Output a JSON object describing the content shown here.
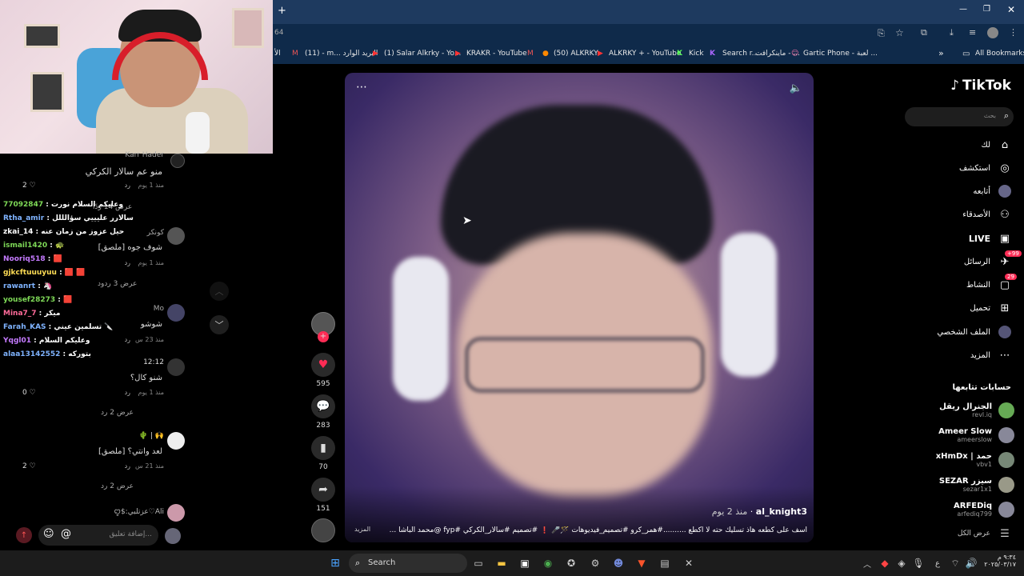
{
  "browser": {
    "address_text": "64",
    "bookmarks": [
      {
        "label": "الأ"
      },
      {
        "label": "(11) - m... البريد الوارد"
      },
      {
        "label": "(1) Salar Alkrky - Yo..."
      },
      {
        "label": "KRAKR - YouTube"
      },
      {
        "label": "(50) ALKRKY"
      },
      {
        "label": "ALKRKY + - YouTube"
      },
      {
        "label": "Kick"
      },
      {
        "label": "Search r..."
      },
      {
        "label": "ماينكرافت - ..."
      },
      {
        "label": "Gartic Phone - لعبة ..."
      }
    ],
    "all_bookmarks": "All Bookmarks"
  },
  "tiktok": {
    "logo": "TikTok",
    "search_placeholder": "بحث",
    "nav": [
      {
        "label": "لك",
        "icon": "home-icon"
      },
      {
        "label": "استكشف",
        "icon": "compass-icon"
      },
      {
        "label": "أتابعه",
        "icon": "avatar-icon"
      },
      {
        "label": "الأصدقاء",
        "icon": "friends-icon"
      },
      {
        "label": "LIVE",
        "icon": "live-icon"
      },
      {
        "label": "الرسائل",
        "icon": "messages-icon",
        "badge": "+99"
      },
      {
        "label": "النشاط",
        "icon": "activity-icon",
        "badge": "29"
      },
      {
        "label": "تحميل",
        "icon": "upload-icon"
      },
      {
        "label": "الملف الشخصي",
        "icon": "profile-icon"
      },
      {
        "label": "المزيد",
        "icon": "more-icon"
      }
    ],
    "following_title": "حسابات تتابعها",
    "following": [
      {
        "name": "الجنرال ريقل",
        "handle": "revl.iq"
      },
      {
        "name": "Ameer Slow",
        "handle": "ameerslow"
      },
      {
        "name": "xHmDx | حمد",
        "handle": "vbv1"
      },
      {
        "name": "SEZAR سيزر",
        "handle": "sezar1x1"
      },
      {
        "name": "ARFEDiq",
        "handle": "arfediq799"
      }
    ],
    "show_all": "عرض الكل"
  },
  "video": {
    "author": "al_knight3",
    "time": "منذ 2 يوم",
    "caption": "اسف على كطعه هاذ تسليك حته لا اكطع ..........#همر_كرو #تصميم_فيديوهات 🪄🎤 ❗ #تصميم #سالار_الكركي #fyp @محمد الباشا ...",
    "more": "المزيد",
    "likes": "595",
    "comments": "283",
    "saves": "70",
    "shares": "151"
  },
  "live_chat": [
    {
      "user": "77092847",
      "color": "#7ed957",
      "text": "وعليكم السلام نورت"
    },
    {
      "user": "Rtha_amir",
      "color": "#7fb3ff",
      "text": "سالارر عليييي سؤالللل"
    },
    {
      "user": "zkai_14",
      "color": "#ffffff",
      "text": "حيل عزوز من زمان عنه"
    },
    {
      "user": "ismail1420",
      "color": "#7ed957",
      "text": "🐢"
    },
    {
      "user": "Nooriq518",
      "color": "#c57bff",
      "text": "🟥"
    },
    {
      "user": "gjkcftuuuyuu",
      "color": "#ffdd55",
      "text": "🟥 🟥"
    },
    {
      "user": "rawanrt",
      "color": "#7fb3ff",
      "text": "🦄"
    },
    {
      "user": "yousef28273",
      "color": "#7ed957",
      "text": "🟥"
    },
    {
      "user": "Mina7_7",
      "color": "#ff6b9a",
      "text": "ميكر"
    },
    {
      "user": "Farah_KAS",
      "color": "#7fb3ff",
      "text": "تسلمين عيني 🔪"
    },
    {
      "user": "Yqgl01",
      "color": "#c57bff",
      "text": "وعليكم السلام"
    },
    {
      "user": "alaa13142552",
      "color": "#7fb3ff",
      "text": "بتوركه"
    }
  ],
  "comments": [
    {
      "user": "Karr Hader",
      "text": "منو عم سالار الكركي",
      "meta": "منذ 1 يوم",
      "reply": "رد",
      "likes": "2",
      "replies": "عرض 14 ردًا"
    },
    {
      "user": "كونكر",
      "text": "[ملصق] شوف جوه",
      "meta": "منذ 1 يوم",
      "reply": "رد",
      "likes": "",
      "replies": "عرض 3 ردود"
    },
    {
      "user": "Mo",
      "text": "شوشو",
      "meta": "منذ 23 س",
      "reply": "رد",
      "likes": "",
      "replies": ""
    },
    {
      "user": "12:12",
      "text": "شنو كال؟",
      "meta": "منذ 1 يوم",
      "reply": "رد",
      "likes": "0",
      "replies": "عرض 2 رد"
    },
    {
      "user": "🌵 | 🙌",
      "text": "[ملصق] لعد وانتي؟",
      "meta": "منذ 21 س",
      "reply": "رد",
      "likes": "2",
      "replies": "عرض 2 رد"
    },
    {
      "user": "ꨄ$:عزتلبي♡Ali",
      "text": "",
      "meta": "",
      "reply": "",
      "likes": "",
      "replies": ""
    }
  ],
  "comment_input_placeholder": "إضافة تعليق...",
  "taskbar": {
    "search": "Search",
    "lang": "ع",
    "time": "٩:٣٤ م",
    "date": "٢٠٢٥/٠٣/١٧"
  }
}
